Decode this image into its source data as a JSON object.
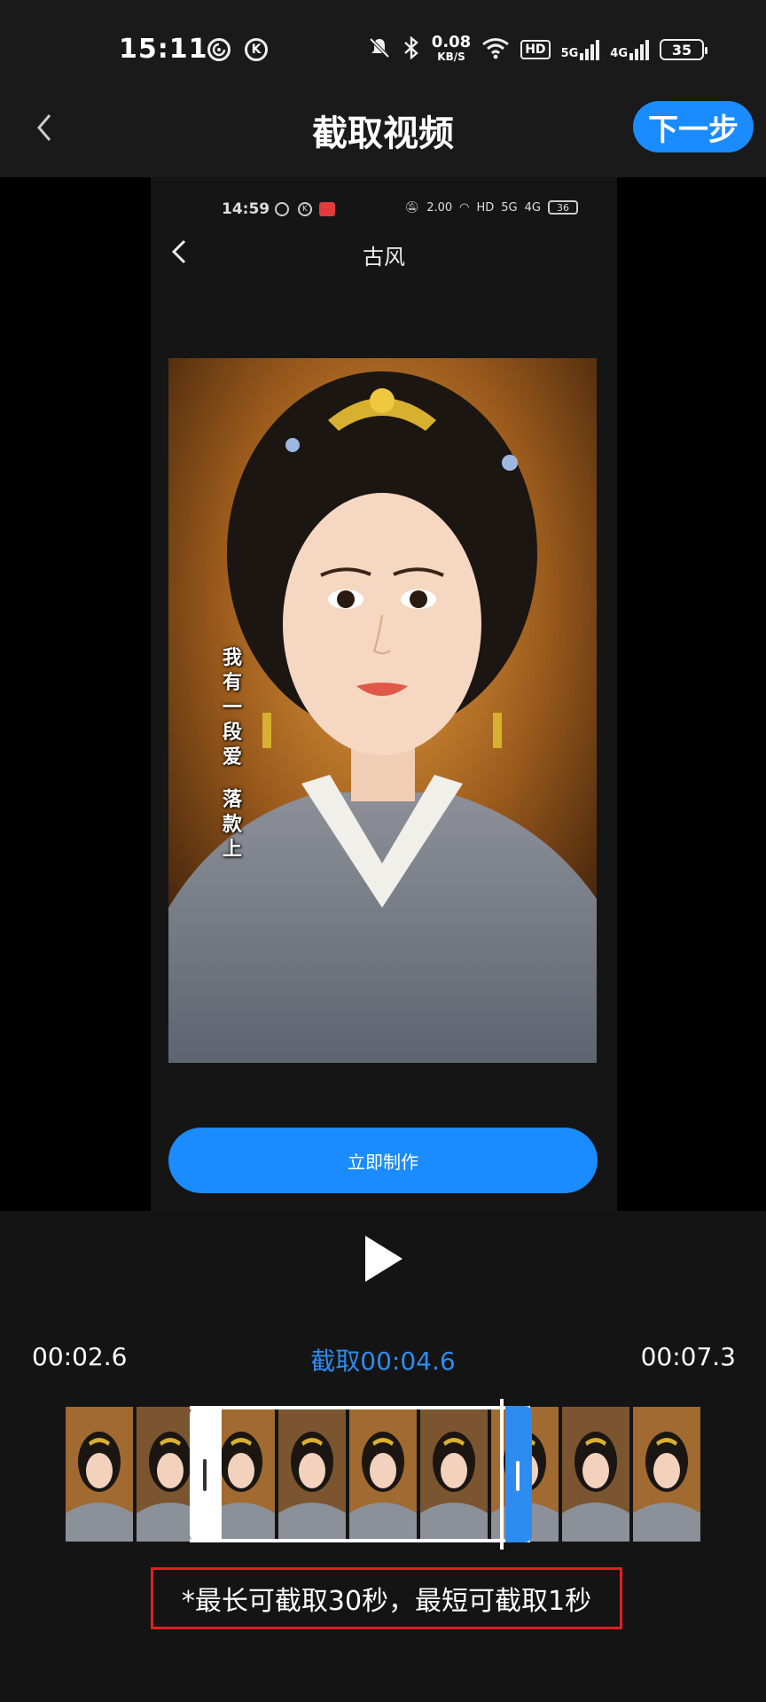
{
  "status_bar": {
    "time": "15:11",
    "icons": [
      "netease-icon",
      "k-icon"
    ],
    "speed_value": "0.08",
    "speed_unit": "KB/S",
    "hd_label": "HD",
    "net1": "5G",
    "net2": "4G",
    "battery": "35"
  },
  "header": {
    "title": "截取视频",
    "next_label": "下一步"
  },
  "preview": {
    "inner_status_time": "14:59",
    "inner_speed": "2.00",
    "inner_battery": "36",
    "inner_title": "古风",
    "vertical_text_col": [
      "我",
      "有",
      "一",
      "段",
      "爱",
      "落",
      "款",
      "上"
    ],
    "make_button_label": "立即制作"
  },
  "trim": {
    "start_time": "00:02.6",
    "cut_label": "截取00:04.6",
    "end_time": "00:07.3",
    "frame_count": 9
  },
  "note": "*最长可截取30秒，最短可截取1秒",
  "colors": {
    "accent": "#1a8cff",
    "cut_text": "#2d8cf0",
    "note_border": "#e02020",
    "background": "#141414"
  }
}
